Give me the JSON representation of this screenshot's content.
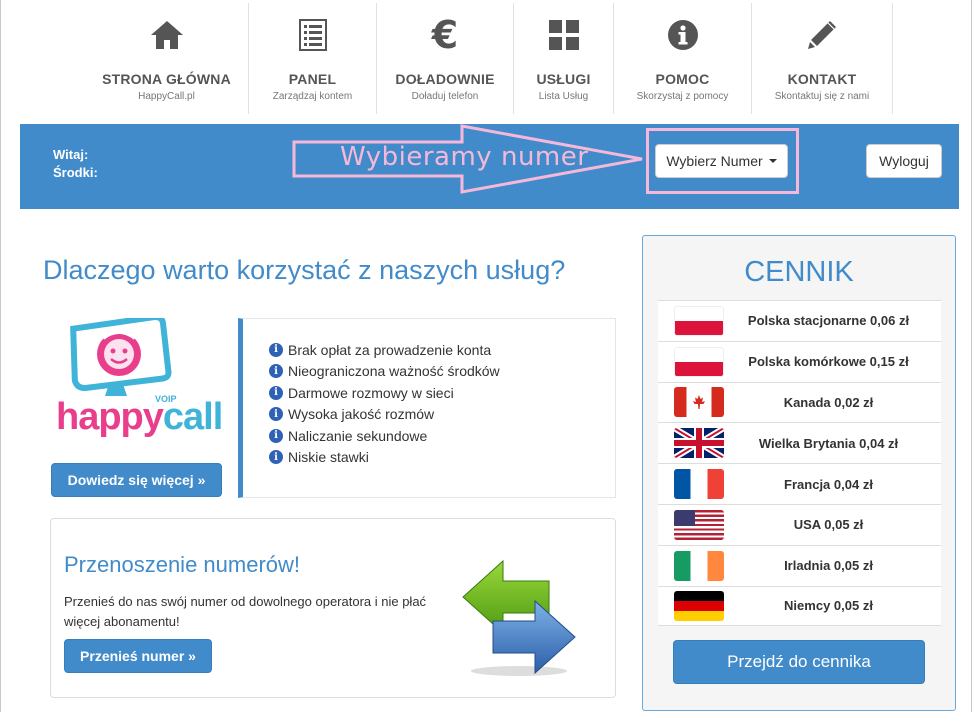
{
  "nav": [
    {
      "title": "STRONA GŁÓWNA",
      "sub": "HappyCall.pl",
      "icon": "home-icon"
    },
    {
      "title": "PANEL",
      "sub": "Zarządzaj kontem",
      "icon": "list-icon"
    },
    {
      "title": "DOŁADOWNIE",
      "sub": "Doładuj telefon",
      "icon": "euro-icon"
    },
    {
      "title": "USŁUGI",
      "sub": "Lista Usług",
      "icon": "grid-icon"
    },
    {
      "title": "POMOC",
      "sub": "Skorzystaj z pomocy",
      "icon": "info-icon"
    },
    {
      "title": "KONTAKT",
      "sub": "Skontaktuj się z nami",
      "icon": "pencil-icon"
    }
  ],
  "bar": {
    "greeting": "Witaj:",
    "funds": "Środki:",
    "annotation": "Wybieramy numer",
    "select_label": "Wybierz Numer",
    "logout_label": "Wyloguj",
    "annotation_color": "#f6b8d8"
  },
  "main": {
    "headline": "Dlaczego warto korzystać z naszych usług?",
    "logo": {
      "part1": "happy",
      "part2": "call",
      "voip": "VOIP"
    },
    "more_button": "Dowiedz się więcej »",
    "features": [
      "Brak opłat za prowadzenie konta",
      "Nieograniczona ważność środków",
      "Darmowe rozmowy w sieci",
      "Wysoka jakość rozmów",
      "Naliczanie sekundowe",
      "Niskie stawki"
    ],
    "porting": {
      "title": "Przenoszenie numerów!",
      "text": "Przenieś do nas swój numer od dowolnego operatora i nie płać więcej abonamentu!",
      "button": "Przenieś numer »"
    }
  },
  "pricing": {
    "title": "CENNIK",
    "rows": [
      {
        "label": "Polska stacjonarne 0,06 zł",
        "flag": "pl"
      },
      {
        "label": "Polska komórkowe 0,15 zł",
        "flag": "pl"
      },
      {
        "label": "Kanada 0,02 zł",
        "flag": "ca"
      },
      {
        "label": "Wielka Brytania 0,04 zł",
        "flag": "gb"
      },
      {
        "label": "Francja 0,04 zł",
        "flag": "fr"
      },
      {
        "label": "USA 0,05 zł",
        "flag": "us"
      },
      {
        "label": "Irladnia 0,05 zł",
        "flag": "ie"
      },
      {
        "label": "Niemcy 0,05 zł",
        "flag": "de"
      }
    ],
    "button": "Przejdź do cennika"
  },
  "colors": {
    "primary": "#428bca",
    "accent_pink": "#e83e8c",
    "accent_teal": "#3fb3d8"
  }
}
